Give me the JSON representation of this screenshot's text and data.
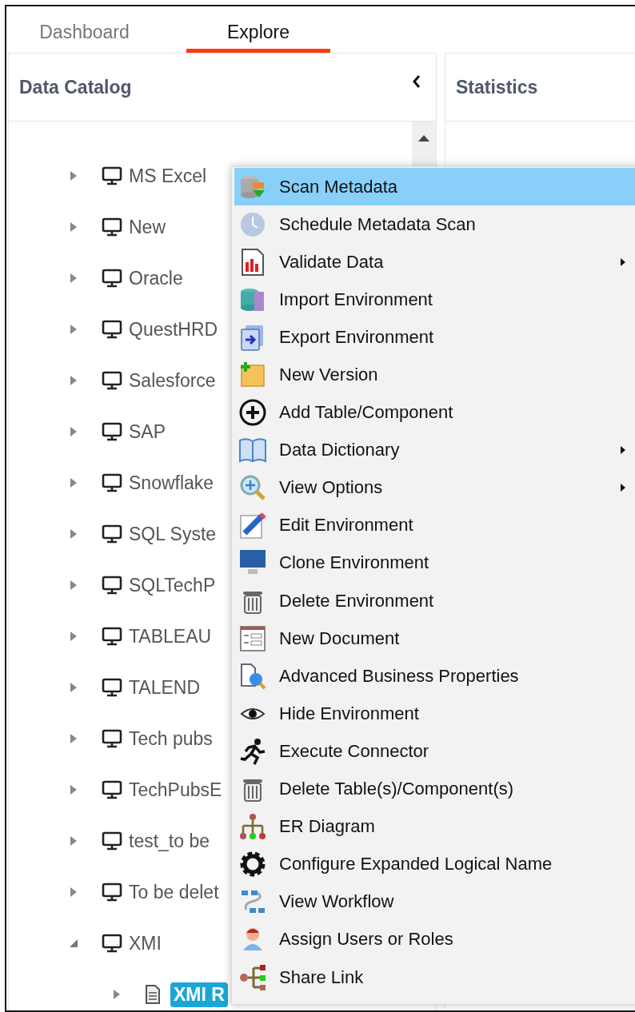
{
  "tabs": [
    {
      "label": "Dashboard",
      "selected": false
    },
    {
      "label": "Explore",
      "selected": true
    }
  ],
  "data_catalog": {
    "title": "Data Catalog",
    "tree": [
      {
        "label": "MS Excel",
        "expanded": false
      },
      {
        "label": "New",
        "expanded": false
      },
      {
        "label": "Oracle",
        "expanded": false
      },
      {
        "label": "QuestHRD",
        "expanded": false
      },
      {
        "label": "Salesforce",
        "expanded": false
      },
      {
        "label": "SAP",
        "expanded": false
      },
      {
        "label": "Snowflake",
        "expanded": false
      },
      {
        "label": "SQL Syste",
        "expanded": false
      },
      {
        "label": "SQLTechP",
        "expanded": false
      },
      {
        "label": "TABLEAU",
        "expanded": false
      },
      {
        "label": "TALEND",
        "expanded": false
      },
      {
        "label": "Tech pubs",
        "expanded": false
      },
      {
        "label": "TechPubsE",
        "expanded": false
      },
      {
        "label": "test_to be",
        "expanded": false
      },
      {
        "label": "To be delet",
        "expanded": false
      },
      {
        "label": "XMI",
        "expanded": true,
        "children": [
          {
            "label": "XMI R",
            "expanded": false,
            "selected": true
          }
        ]
      }
    ]
  },
  "statistics": {
    "title": "Statistics"
  },
  "context_menu": [
    {
      "label": "Scan Metadata",
      "selected": true,
      "has_submenu": false
    },
    {
      "label": "Schedule Metadata Scan",
      "selected": false,
      "has_submenu": false
    },
    {
      "label": "Validate Data",
      "selected": false,
      "has_submenu": true
    },
    {
      "label": "Import Environment",
      "selected": false,
      "has_submenu": false
    },
    {
      "label": "Export Environment",
      "selected": false,
      "has_submenu": false
    },
    {
      "label": "New Version",
      "selected": false,
      "has_submenu": false
    },
    {
      "label": "Add Table/Component",
      "selected": false,
      "has_submenu": false
    },
    {
      "label": "Data Dictionary",
      "selected": false,
      "has_submenu": true
    },
    {
      "label": "View Options",
      "selected": false,
      "has_submenu": true
    },
    {
      "label": "Edit Environment",
      "selected": false,
      "has_submenu": false
    },
    {
      "label": "Clone Environment",
      "selected": false,
      "has_submenu": false
    },
    {
      "label": "Delete Environment",
      "selected": false,
      "has_submenu": false
    },
    {
      "label": "New Document",
      "selected": false,
      "has_submenu": false
    },
    {
      "label": "Advanced Business Properties",
      "selected": false,
      "has_submenu": false
    },
    {
      "label": "Hide Environment",
      "selected": false,
      "has_submenu": false
    },
    {
      "label": "Execute Connector",
      "selected": false,
      "has_submenu": false
    },
    {
      "label": "Delete Table(s)/Component(s)",
      "selected": false,
      "has_submenu": false
    },
    {
      "label": "ER Diagram",
      "selected": false,
      "has_submenu": false
    },
    {
      "label": "Configure Expanded Logical Name",
      "selected": false,
      "has_submenu": false
    },
    {
      "label": "View Workflow",
      "selected": false,
      "has_submenu": false
    },
    {
      "label": "Assign Users or Roles",
      "selected": false,
      "has_submenu": false
    },
    {
      "label": "Share Link",
      "selected": false,
      "has_submenu": false
    }
  ]
}
